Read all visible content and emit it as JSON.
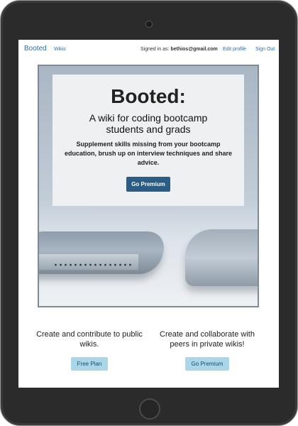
{
  "navbar": {
    "brand": "Booted",
    "wikis_link": "Wikis",
    "signed_in_label": "Signed in as:",
    "signed_in_email": "bethios@gmail.com",
    "edit_profile": "Edit profile",
    "sign_out": "Sign Out"
  },
  "hero": {
    "title": "Booted:",
    "subtitle": "A wiki for coding bootcamp students and grads",
    "description": "Supplement skills missing from your bootcamp education, brush up on interview techniques and share advice.",
    "cta_label": "Go Premium"
  },
  "plans": [
    {
      "text": "Create and contribute to public wikis.",
      "button_label": "Free Plan"
    },
    {
      "text": "Create and collaborate with peers in private wikis!",
      "button_label": "Go Premium"
    }
  ],
  "colors": {
    "link": "#2a6fb5",
    "primary_button": "#2b5c86",
    "secondary_button": "#a9d6e8",
    "device_frame": "#2b2b2b"
  }
}
